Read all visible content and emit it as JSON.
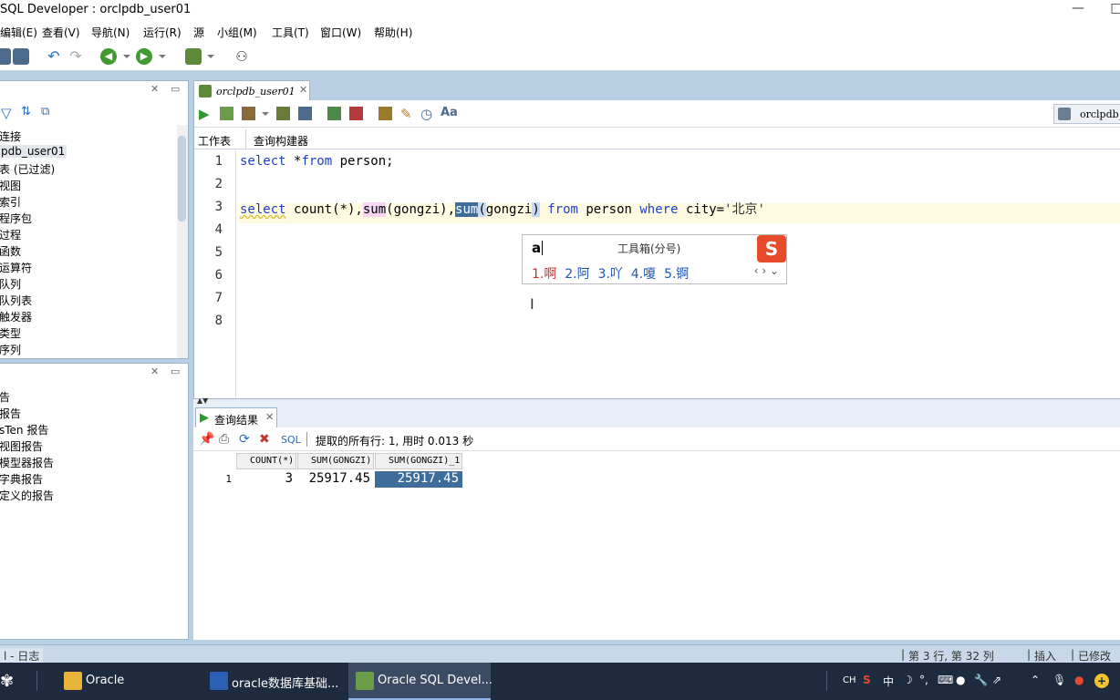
{
  "window": {
    "title": "SQL Developer : orclpdb_user01"
  },
  "menu": [
    "编辑(E)",
    "查看(V)",
    "导航(N)",
    "运行(R)",
    "源",
    "小组(M)",
    "工具(T)",
    "窗口(W)",
    "帮助(H)"
  ],
  "connections_tree": [
    "连接",
    "pdb_user01",
    "表 (已过滤)",
    "视图",
    "索引",
    "程序包",
    "过程",
    "函数",
    "运算符",
    "队列",
    "队列表",
    "触发器",
    "类型",
    "序列"
  ],
  "reports_tree": [
    "告",
    "报告",
    "sTen 报告",
    "视图报告",
    "模型器报告",
    "字典报告",
    "定义的报告"
  ],
  "editor": {
    "tab_label": "orclpdb_user01",
    "connection_dropdown": "orclpdb_",
    "subtabs": [
      "工作表",
      "查询构建器"
    ],
    "line_numbers": [
      "1",
      "2",
      "3",
      "4",
      "5",
      "6",
      "7",
      "8"
    ],
    "lines": {
      "l1_kw": "select",
      "l1_rest": " *",
      "l1_kw2": "from",
      "l1_tail": " person;",
      "l3_kw": "select",
      "l3_a": " count(*),",
      "l3_sum1": "sum",
      "l3_b": "(gongzi),",
      "l3_sum2": "sum",
      "l3_paren": "(",
      "l3_c": "gongzi",
      "l3_close": ")",
      "l3_from": " from",
      "l3_d": " person",
      "l3_where": " where",
      "l3_e": " city=",
      "l3_str": "'北京'"
    }
  },
  "ime": {
    "composition": "a",
    "toolbox": "工具箱(分号)",
    "candidates": [
      "1.啊",
      "2.阿",
      "3.吖",
      "4.嗄",
      "5.锕"
    ],
    "logo": "S"
  },
  "results": {
    "tab_label": "查询结果",
    "sql_label": "SQL",
    "fetch_info": "提取的所有行: 1, 用时 0.013 秒",
    "columns": [
      "COUNT(*)",
      "SUM(GONGZI)",
      "SUM(GONGZI)_1"
    ],
    "rows": [
      {
        "num": "1",
        "count": "3",
        "sum": "25917.45",
        "sum1": "25917.45"
      }
    ]
  },
  "status": {
    "left": "l - 日志",
    "position": "第 3 行, 第 32 列",
    "mode": "插入",
    "modified": "已修改"
  },
  "taskbar": {
    "tasks": [
      "Oracle",
      "oracle数据库基础...",
      "Oracle SQL Devel..."
    ],
    "tray": [
      "CH",
      "中"
    ]
  }
}
